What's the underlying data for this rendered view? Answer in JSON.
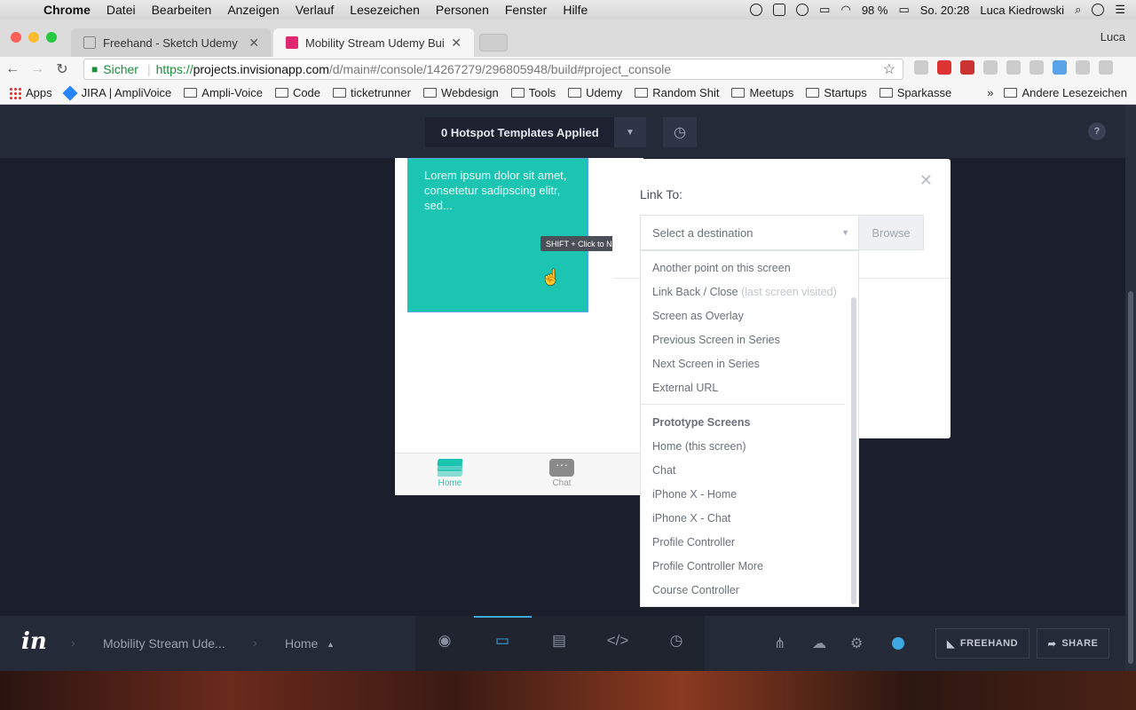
{
  "menubar": {
    "app": "Chrome",
    "items": [
      "Datei",
      "Bearbeiten",
      "Anzeigen",
      "Verlauf",
      "Lesezeichen",
      "Personen",
      "Fenster",
      "Hilfe"
    ],
    "battery": "98 %",
    "clock": "So. 20:28",
    "user": "Luca Kiedrowski"
  },
  "tabs": [
    {
      "title": "Freehand - Sketch Udemy"
    },
    {
      "title": "Mobility Stream Udemy Build M"
    }
  ],
  "profile": "Luca",
  "address": {
    "secure_label": "Sicher",
    "scheme": "https://",
    "host": "projects.invisionapp.com",
    "path": "/d/main#/console/14267279/296805948/build#project_console"
  },
  "bookmarks": {
    "items": [
      "Apps",
      "JIRA | AmpliVoice",
      "Ampli-Voice",
      "Code",
      "ticketrunner",
      "Webdesign",
      "Tools",
      "Udemy",
      "Random Shit",
      "Meetups",
      "Startups",
      "Sparkasse"
    ],
    "more": "»",
    "other": "Andere Lesezeichen"
  },
  "topbar": {
    "hotspot_label": "0 Hotspot Templates Applied",
    "help": "?"
  },
  "phone": {
    "card_text": "Lorem ipsum dolor sit amet, consetetur sadipscing elitr, sed...",
    "tab_home": "Home",
    "tab_chat": "Chat"
  },
  "tooltip": "SHIFT + Click to Navigate",
  "panel": {
    "title": "Link To:",
    "select_placeholder": "Select a destination",
    "browse": "Browse",
    "options": [
      {
        "label": "Another point on this screen"
      },
      {
        "label": "Link Back / Close",
        "muted": "(last screen visited)"
      },
      {
        "label": "Screen as Overlay"
      },
      {
        "label": "Previous Screen in Series"
      },
      {
        "label": "Next Screen in Series"
      },
      {
        "label": "External URL"
      }
    ],
    "screens_header": "Prototype Screens",
    "screens": [
      "Home (this screen)",
      "Chat",
      "iPhone X - Home",
      "iPhone X - Chat",
      "Profile Controller",
      "Profile Controller More",
      "Course Controller"
    ]
  },
  "bottombar": {
    "logo": "in",
    "project": "Mobility Stream Ude...",
    "screen": "Home",
    "freehand": "FREEHAND",
    "share": "SHARE",
    "accent": "#3ea8e0"
  }
}
